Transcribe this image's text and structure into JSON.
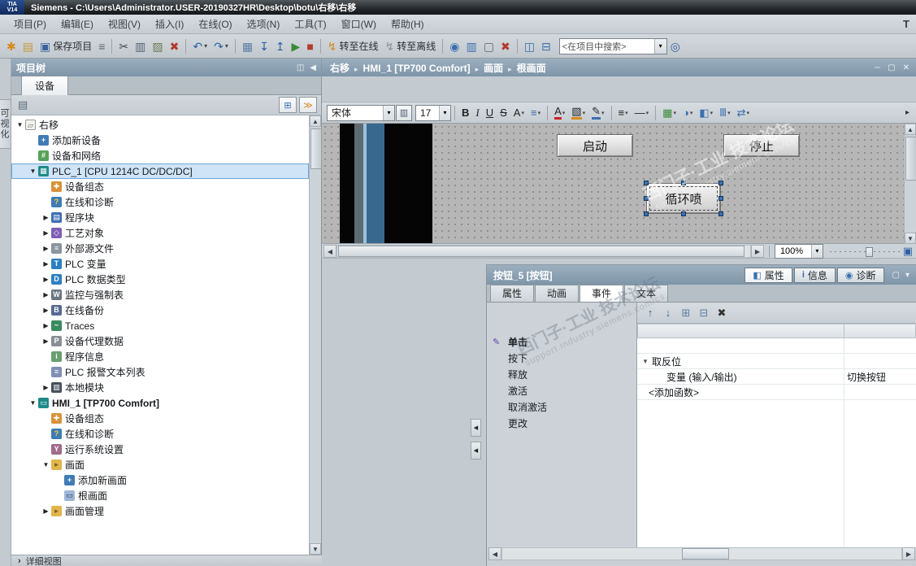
{
  "window": {
    "logo_top": "TIA",
    "logo_bottom": "V14",
    "title": "Siemens  -  C:\\Users\\Administrator.USER-20190327HR\\Desktop\\botu\\右移\\右移",
    "portal_corner": "T"
  },
  "menu": {
    "items": [
      "项目(P)",
      "编辑(E)",
      "视图(V)",
      "插入(I)",
      "在线(O)",
      "选项(N)",
      "工具(T)",
      "窗口(W)",
      "帮助(H)"
    ]
  },
  "toolbar": {
    "search_value": "<在项目中搜索>",
    "items": [
      {
        "name": "new-project-icon",
        "glyph": "✱",
        "color": "#d78a1e"
      },
      {
        "name": "open-project-icon",
        "glyph": "▤",
        "color": "#c79a3a"
      },
      {
        "name": "save-project-button",
        "glyph": "▣",
        "color": "#3a62a0",
        "label": "保存项目"
      },
      {
        "name": "print-icon",
        "glyph": "≡",
        "color": "#5a6570"
      },
      {
        "sep": true
      },
      {
        "name": "cut-icon",
        "glyph": "✂",
        "color": "#444444"
      },
      {
        "name": "copy-icon",
        "glyph": "▥",
        "color": "#556070"
      },
      {
        "name": "paste-icon",
        "glyph": "▨",
        "color": "#6a7a50"
      },
      {
        "name": "delete-icon",
        "glyph": "✖",
        "color": "#b23b30"
      },
      {
        "sep": true
      },
      {
        "name": "undo-icon",
        "glyph": "↶",
        "color": "#2f5fa3",
        "dd": true
      },
      {
        "name": "redo-icon",
        "glyph": "↷",
        "color": "#2f5fa3",
        "dd": true
      },
      {
        "sep": true
      },
      {
        "name": "compile-icon",
        "glyph": "▦",
        "color": "#5b7ea8"
      },
      {
        "name": "download-to-device-icon",
        "glyph": "↧",
        "color": "#2f5fa3"
      },
      {
        "name": "upload-from-device-icon",
        "glyph": "↥",
        "color": "#2f5fa3"
      },
      {
        "name": "start-cpu-icon",
        "glyph": "▶",
        "color": "#3a8a3a"
      },
      {
        "name": "stop-cpu-icon",
        "glyph": "■",
        "color": "#b23b30"
      },
      {
        "sep": true
      },
      {
        "name": "go-online-button",
        "glyph": "↯",
        "color": "#d78a1e",
        "label": "转至在线"
      },
      {
        "name": "go-offline-button",
        "glyph": "↯",
        "color": "#8a949c",
        "label": "转至离线"
      },
      {
        "sep": true
      },
      {
        "name": "online-diagnostics-icon",
        "glyph": "◉",
        "color": "#3a6fae"
      },
      {
        "name": "accessible-devices-icon",
        "glyph": "▥",
        "color": "#3a6fae"
      },
      {
        "name": "receive-alarms-icon",
        "glyph": "▢",
        "color": "#5a6570"
      },
      {
        "name": "remove-highlight-icon",
        "glyph": "✖",
        "color": "#b23b30"
      },
      {
        "sep": true
      },
      {
        "name": "split-horizontal-icon",
        "glyph": "◫",
        "color": "#3a6fae"
      },
      {
        "name": "split-vertical-icon",
        "glyph": "⊟",
        "color": "#3a6fae"
      },
      {
        "search": true,
        "name": "project-search-input"
      },
      {
        "name": "search-icon",
        "glyph": "◎",
        "color": "#2f5fa3"
      }
    ]
  },
  "left_strip": {
    "tab": "可视化"
  },
  "tree": {
    "header": "项目树",
    "header_icons": [
      {
        "name": "dock-panel-icon",
        "glyph": "◫"
      },
      {
        "name": "collapse-panel-icon",
        "glyph": "◀"
      }
    ],
    "tab": "设备",
    "toolbar_left": [
      {
        "name": "filter-icon",
        "glyph": "▤"
      }
    ],
    "toolbar_right": [
      {
        "name": "list-view-icon",
        "glyph": "⊞",
        "color": "#3a6fae"
      },
      {
        "name": "expand-all-icon",
        "glyph": "≫",
        "color": "#d78a1e"
      }
    ],
    "detail_view": "详细视图",
    "items": [
      {
        "id": "root-project",
        "label": "右移",
        "level": 0,
        "exp": "open",
        "icon": "project"
      },
      {
        "id": "add-new-device",
        "label": "添加新设备",
        "level": 1,
        "icon": "add-device"
      },
      {
        "id": "devices-and-networks",
        "label": "设备和网络",
        "level": 1,
        "icon": "network"
      },
      {
        "id": "plc-1",
        "label": "PLC_1 [CPU 1214C DC/DC/DC]",
        "level": 1,
        "exp": "open",
        "icon": "plc",
        "selected": true
      },
      {
        "id": "plc-device-configuration",
        "label": "设备组态",
        "level": 2,
        "icon": "config"
      },
      {
        "id": "plc-online-diagnostics",
        "label": "在线和诊断",
        "level": 2,
        "icon": "diagnostics"
      },
      {
        "id": "program-blocks",
        "label": "程序块",
        "level": 2,
        "exp": "closed",
        "icon": "blocks"
      },
      {
        "id": "technology-objects",
        "label": "工艺对象",
        "level": 2,
        "exp": "closed",
        "icon": "tech"
      },
      {
        "id": "external-source-files",
        "label": "外部源文件",
        "level": 2,
        "exp": "closed",
        "icon": "sources"
      },
      {
        "id": "plc-tags",
        "label": "PLC 变量",
        "level": 2,
        "exp": "closed",
        "icon": "tags"
      },
      {
        "id": "plc-data-types",
        "label": "PLC 数据类型",
        "level": 2,
        "exp": "closed",
        "icon": "datatypes"
      },
      {
        "id": "watch-and-force-tables",
        "label": "监控与强制表",
        "level": 2,
        "exp": "closed",
        "icon": "watch"
      },
      {
        "id": "online-backups",
        "label": "在线备份",
        "level": 2,
        "exp": "closed",
        "icon": "backup"
      },
      {
        "id": "traces",
        "label": "Traces",
        "level": 2,
        "exp": "closed",
        "icon": "traces"
      },
      {
        "id": "device-proxy-data",
        "label": "设备代理数据",
        "level": 2,
        "exp": "closed",
        "icon": "proxy"
      },
      {
        "id": "program-info",
        "label": "程序信息",
        "level": 2,
        "icon": "proginfo"
      },
      {
        "id": "plc-alarm-text-lists",
        "label": "PLC 报警文本列表",
        "level": 2,
        "icon": "alarmtext"
      },
      {
        "id": "local-modules",
        "label": "本地模块",
        "level": 2,
        "exp": "closed",
        "icon": "modules"
      },
      {
        "id": "hmi-1",
        "label": "HMI_1 [TP700 Comfort]",
        "level": 1,
        "exp": "open",
        "icon": "hmi",
        "bold": true
      },
      {
        "id": "hmi-device-configuration",
        "label": "设备组态",
        "level": 2,
        "icon": "config"
      },
      {
        "id": "hmi-online-diagnostics",
        "label": "在线和诊断",
        "level": 2,
        "icon": "diagnostics"
      },
      {
        "id": "runtime-settings",
        "label": "运行系统设置",
        "level": 2,
        "icon": "runtime"
      },
      {
        "id": "screens",
        "label": "画面",
        "level": 2,
        "exp": "open",
        "icon": "folder"
      },
      {
        "id": "add-new-screen",
        "label": "添加新画面",
        "level": 3,
        "icon": "add-screen"
      },
      {
        "id": "root-screen",
        "label": "根画面",
        "level": 3,
        "icon": "screen"
      },
      {
        "id": "screen-management",
        "label": "画面管理",
        "level": 2,
        "exp": "closed",
        "icon": "folder"
      }
    ]
  },
  "editor": {
    "breadcrumb": [
      "右移",
      "HMI_1 [TP700 Comfort]",
      "画面",
      "根画面"
    ],
    "window_icons": [
      {
        "name": "minimize-window-icon",
        "glyph": "─"
      },
      {
        "name": "restore-window-icon",
        "glyph": "▢"
      },
      {
        "name": "close-window-icon",
        "glyph": "✕"
      }
    ],
    "font_name": "宋体",
    "font_size": "17",
    "zoom": "100%",
    "format_tools": [
      {
        "name": "bold-icon",
        "glyph": "B",
        "cls": "fb"
      },
      {
        "name": "italic-icon",
        "glyph": "I",
        "cls": "fi"
      },
      {
        "name": "underline-icon",
        "glyph": "U",
        "cls": "fu"
      },
      {
        "name": "strikethrough-icon",
        "glyph": "S",
        "cls": "fs"
      },
      {
        "name": "font-size-icon",
        "glyph": "A",
        "dd": true
      },
      {
        "name": "align-icon",
        "glyph": "≡",
        "color": "#3a6fae",
        "dd": true
      },
      {
        "sep": true
      },
      {
        "name": "font-color-icon",
        "glyph": "A",
        "bar": "#cc2222",
        "dd": true
      },
      {
        "name": "background-color-icon",
        "glyph": "▧",
        "bar": "#d78a1e",
        "dd": true
      },
      {
        "name": "border-color-icon",
        "glyph": "✎",
        "bar": "#3a6fae",
        "dd": true
      },
      {
        "sep": true
      },
      {
        "name": "line-weight-icon",
        "glyph": "≡",
        "dd": true
      },
      {
        "name": "line-style-icon",
        "glyph": "—",
        "dd": true
      },
      {
        "sep": true
      },
      {
        "name": "fill-pattern-icon",
        "glyph": "▦",
        "color": "#3a8a3a",
        "dd": true
      },
      {
        "name": "corner-radius-icon",
        "glyph": "◑",
        "color": "#3a6fae",
        "dd": true
      },
      {
        "name": "flip-icon",
        "glyph": "◧",
        "color": "#3a6fae",
        "dd": true
      },
      {
        "name": "layer-icon",
        "glyph": "Ⅲ",
        "color": "#3a6fae",
        "dd": true
      },
      {
        "name": "tab-order-icon",
        "glyph": "⇄",
        "color": "#3a6fae",
        "dd": true
      }
    ],
    "buttons": [
      {
        "name": "start-button",
        "label": "启动"
      },
      {
        "name": "stop-button",
        "label": "停止"
      },
      {
        "name": "loop-spray-button",
        "label": "循环喷",
        "selected": true
      }
    ],
    "watermark": {
      "line1": "西门子·工业  技术论坛",
      "line2": "support.industry.siemens.com/cs"
    }
  },
  "inspector": {
    "title": "按钮_5 [按钮]",
    "header_tabs": [
      {
        "name": "tab-properties",
        "label": "属性",
        "icon": "◧",
        "active": true
      },
      {
        "name": "tab-info",
        "label": "信息",
        "icon": "i"
      },
      {
        "name": "tab-diagnostics",
        "label": "诊断",
        "icon": "◉"
      }
    ],
    "header_icons": [
      {
        "name": "float-inspector-icon",
        "glyph": "▢"
      },
      {
        "name": "collapse-inspector-icon",
        "glyph": "▾"
      }
    ],
    "tabs": [
      {
        "id": "properties",
        "label": "属性"
      },
      {
        "id": "animations",
        "label": "动画"
      },
      {
        "id": "events",
        "label": "事件",
        "active": true
      },
      {
        "id": "texts",
        "label": "文本"
      }
    ],
    "events": [
      {
        "id": "click",
        "label": "单击",
        "selected": true
      },
      {
        "id": "press",
        "label": "按下"
      },
      {
        "id": "release",
        "label": "释放"
      },
      {
        "id": "activate",
        "label": "激活"
      },
      {
        "id": "deactivate",
        "label": "取消激活"
      },
      {
        "id": "change",
        "label": "更改"
      }
    ],
    "fn_toolbar": [
      {
        "name": "move-up-icon",
        "glyph": "↑",
        "color": "#2f5fa3"
      },
      {
        "name": "move-down-icon",
        "glyph": "↓",
        "color": "#2f5fa3"
      },
      {
        "name": "expand-table-icon",
        "glyph": "⊞",
        "color": "#5b7ea8"
      },
      {
        "name": "collapse-table-icon",
        "glyph": "⊟",
        "color": "#5b7ea8"
      },
      {
        "name": "delete-function-icon",
        "glyph": "✖",
        "color": "#333333"
      }
    ],
    "table": {
      "function_name": "取反位",
      "param_label": "变量 (输入/输出)",
      "param_value": "切换按钮",
      "add_function": "<添加函数>"
    },
    "watermark": {
      "line1": "西门子·工业  技术论坛",
      "line2": "support.industry.siemens.com/cs"
    }
  },
  "glyphs": {
    "caret": "▾",
    "crumb_sep": "▸",
    "expander_open": "▼",
    "expander_closed": "▶",
    "detail_chevron": "›",
    "left": "◀",
    "right": "▶",
    "up": "▲",
    "down": "▼",
    "event_marker": "✎",
    "fn_expander": "▼",
    "fit": "▣",
    "more": "▸",
    "grid": "▥"
  },
  "colors": {
    "header_bar": "#8aa0b2",
    "selection": "#cfe4f7",
    "accent_blue": "#2f5fa3"
  }
}
